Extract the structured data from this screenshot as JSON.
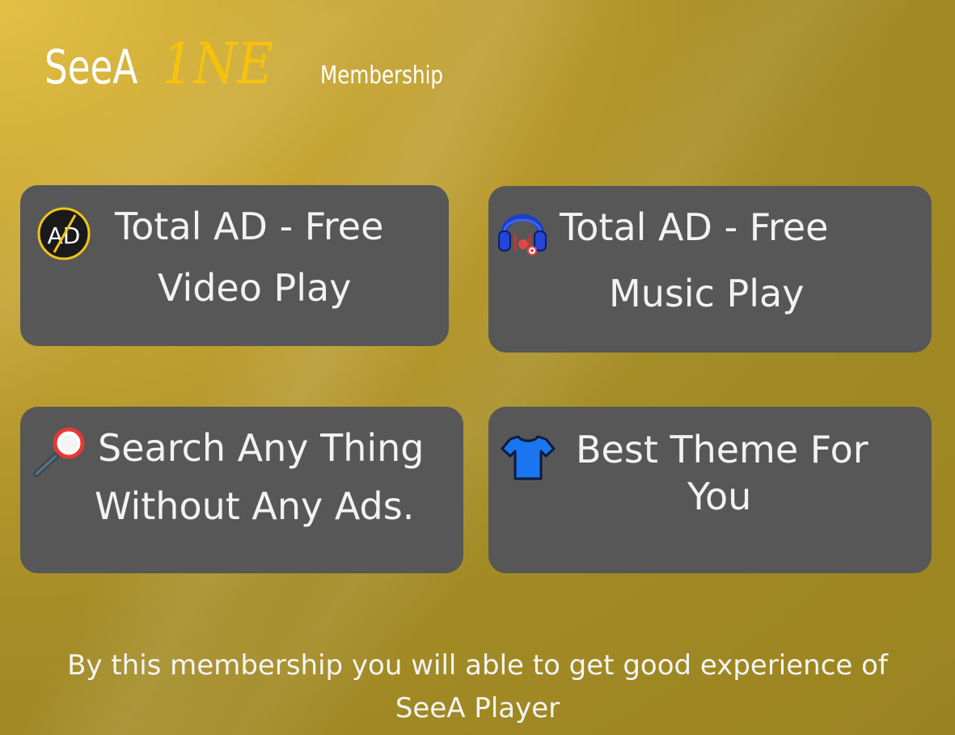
{
  "brand": {
    "name_part1": "SeeA",
    "name_part2": "1NE",
    "section_label": "Membership"
  },
  "features": {
    "video": {
      "line1": "Total AD - Free",
      "line2": "Video Play",
      "icon": "ad-blocked-icon"
    },
    "music": {
      "line1": "Total AD - Free",
      "line2": "Music Play",
      "icon": "headphones-icon"
    },
    "search": {
      "line1": "Search Any Thing",
      "line2": "Without Any Ads.",
      "icon": "magnifier-icon"
    },
    "theme": {
      "line1": "Best Theme For",
      "line2": "You",
      "icon": "tshirt-icon"
    }
  },
  "footer": {
    "line1": "By this membership you will able to get good experience of",
    "line2": "SeeA Player"
  },
  "colors": {
    "background": "#b09628",
    "card": "#575757",
    "accent_gold": "#f6c20c",
    "text": "#ffffff"
  }
}
